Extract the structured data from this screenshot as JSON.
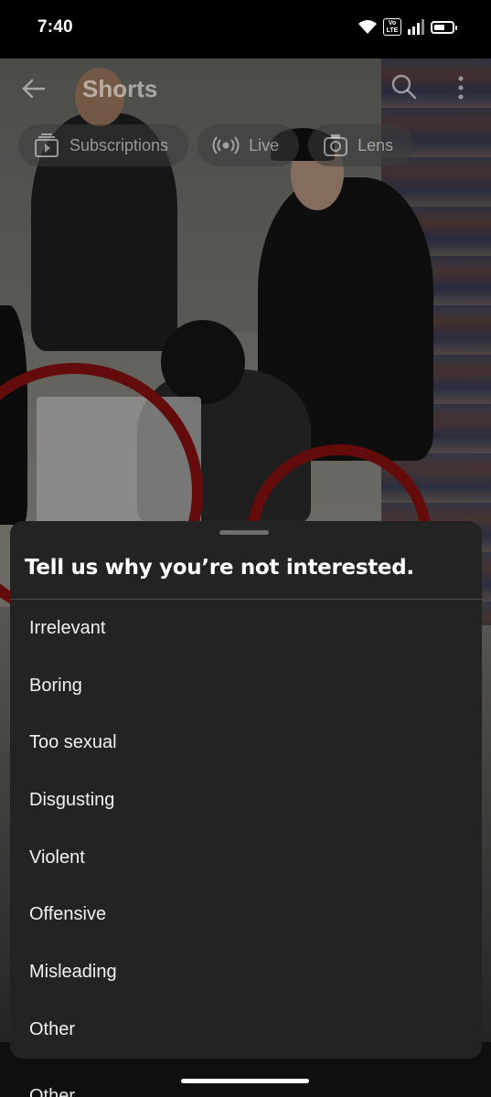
{
  "status_bar": {
    "time": "7:40",
    "volte_label": "Vo LTE",
    "icons": [
      "wifi-icon",
      "volte-icon",
      "signal-icon",
      "battery-icon"
    ]
  },
  "header": {
    "title": "Shorts",
    "icons": [
      "back-arrow-icon",
      "search-icon",
      "more-vertical-icon"
    ]
  },
  "chips": [
    {
      "label": "Subscriptions",
      "icon": "subscriptions-icon"
    },
    {
      "label": "Live",
      "icon": "live-icon"
    },
    {
      "label": "Lens",
      "icon": "lens-icon"
    }
  ],
  "sheet": {
    "title": "Tell us why you’re not interested.",
    "reasons": [
      "Irrelevant",
      "Boring",
      "Too sexual",
      "Disgusting",
      "Violent",
      "Offensive",
      "Misleading",
      "Other"
    ]
  },
  "peek_text": "Other",
  "colors": {
    "sheet_background": "#232323",
    "highlight_circle": "#8b1010",
    "text_primary": "#f1f1f1"
  }
}
